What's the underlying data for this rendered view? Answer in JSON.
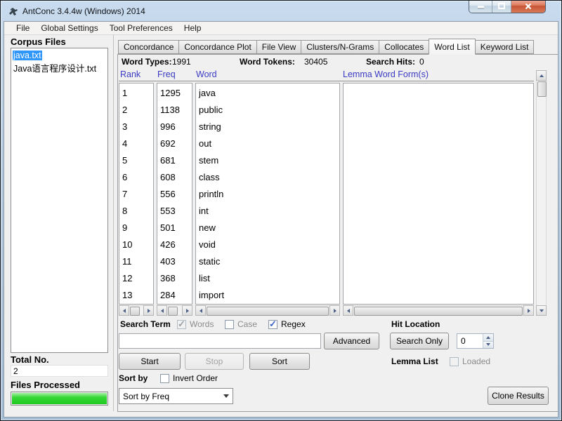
{
  "window": {
    "title": "AntConc 3.4.4w (Windows) 2014"
  },
  "menu": {
    "items": [
      "File",
      "Global Settings",
      "Tool Preferences",
      "Help"
    ]
  },
  "corpus": {
    "title": "Corpus Files",
    "files": [
      {
        "name": "java.txt",
        "selected": true
      },
      {
        "name": "Java语言程序设计.txt",
        "selected": false
      }
    ],
    "total_label": "Total No.",
    "total_value": "2",
    "processed_label": "Files Processed",
    "progress_percent": 100
  },
  "tabs": [
    {
      "label": "Concordance",
      "active": false
    },
    {
      "label": "Concordance Plot",
      "active": false
    },
    {
      "label": "File View",
      "active": false
    },
    {
      "label": "Clusters/N-Grams",
      "active": false
    },
    {
      "label": "Collocates",
      "active": false
    },
    {
      "label": "Word List",
      "active": true
    },
    {
      "label": "Keyword List",
      "active": false
    }
  ],
  "stats": {
    "word_types_label": "Word Types:",
    "word_types_value": "1991",
    "word_tokens_label": "Word Tokens:",
    "word_tokens_value": "30405",
    "search_hits_label": "Search Hits:",
    "search_hits_value": "0"
  },
  "wordlist": {
    "columns": [
      "Rank",
      "Freq",
      "Word",
      "Lemma Word Form(s)"
    ],
    "rows": [
      {
        "rank": "1",
        "freq": "1295",
        "word": "java"
      },
      {
        "rank": "2",
        "freq": "1138",
        "word": "public"
      },
      {
        "rank": "3",
        "freq": "996",
        "word": "string"
      },
      {
        "rank": "4",
        "freq": "692",
        "word": "out"
      },
      {
        "rank": "5",
        "freq": "681",
        "word": "stem"
      },
      {
        "rank": "6",
        "freq": "608",
        "word": "class"
      },
      {
        "rank": "7",
        "freq": "556",
        "word": "println"
      },
      {
        "rank": "8",
        "freq": "553",
        "word": "int"
      },
      {
        "rank": "9",
        "freq": "501",
        "word": "new"
      },
      {
        "rank": "10",
        "freq": "426",
        "word": "void"
      },
      {
        "rank": "11",
        "freq": "403",
        "word": "static"
      },
      {
        "rank": "12",
        "freq": "368",
        "word": "list"
      },
      {
        "rank": "13",
        "freq": "284",
        "word": "import"
      }
    ],
    "lemma_rows": []
  },
  "search": {
    "label": "Search Term",
    "checkboxes": {
      "words": {
        "label": "Words",
        "checked": true,
        "disabled": true
      },
      "case": {
        "label": "Case",
        "checked": false,
        "disabled": false
      },
      "regex": {
        "label": "Regex",
        "checked": true,
        "disabled": false
      }
    },
    "input_value": "",
    "advanced_label": "Advanced",
    "hit_location_label": "Hit Location",
    "search_only_label": "Search Only",
    "hit_location_value": "0"
  },
  "controls": {
    "start_label": "Start",
    "stop_label": "Stop",
    "sort_label": "Sort",
    "lemma_list_label": "Lemma List",
    "loaded": {
      "label": "Loaded",
      "checked": false,
      "disabled": true
    },
    "sort_by_label": "Sort by",
    "invert_order": {
      "label": "Invert Order",
      "checked": false,
      "disabled": false
    },
    "sort_dropdown_value": "Sort by Freq",
    "clone_label": "Clone Results"
  },
  "colors": {
    "selection_blue": "#2f96fb",
    "column_header_blue": "#3b3bc4",
    "progress_green": "#2bd42b",
    "close_button_red": "#c85434"
  }
}
